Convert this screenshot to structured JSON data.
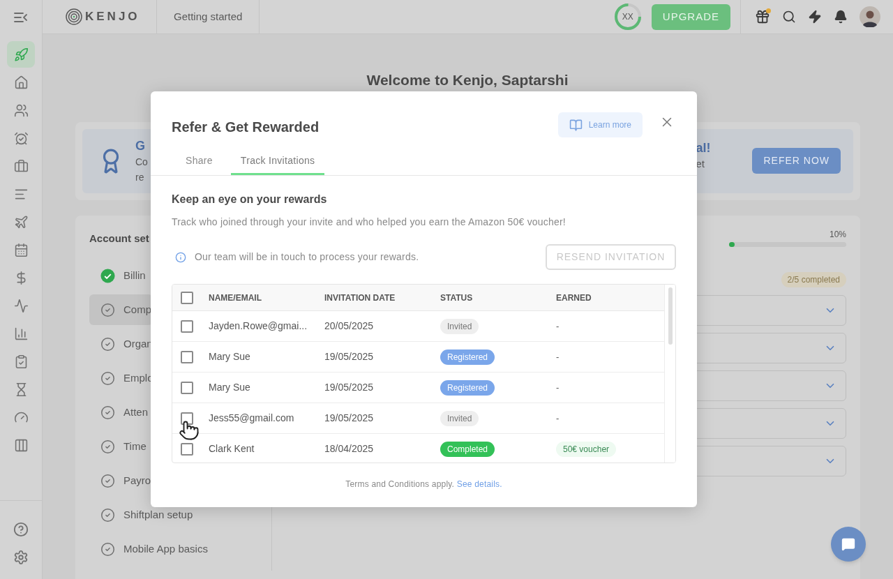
{
  "header": {
    "logo": "KENJO",
    "section": "Getting started",
    "progress": {
      "initials": "XX",
      "level": 0.75
    },
    "upgrade": "UPGRADE",
    "gift_notification": true
  },
  "sidebar": {
    "items": [
      {
        "selected": true
      },
      {
        "selected": false
      },
      {
        "selected": false
      },
      {
        "selected": false
      },
      {
        "selected": false
      },
      {
        "selected": false
      },
      {
        "selected": false
      },
      {
        "selected": false
      },
      {
        "selected": false
      },
      {
        "selected": false
      },
      {
        "selected": false
      },
      {
        "selected": false
      },
      {
        "selected": false
      },
      {
        "selected": false
      },
      {
        "selected": false
      }
    ]
  },
  "welcome": "Welcome to Kenjo, Saptarshi",
  "banner": {
    "title_start": "G",
    "line1_start": "Co",
    "line2_start": "re",
    "title_end": "al!",
    "line1_end": "et",
    "button": "REFER NOW"
  },
  "setup": {
    "title": "Account set",
    "items": [
      {
        "label": "Billin",
        "done": true,
        "selected": false
      },
      {
        "label": "Comp",
        "done": false,
        "selected": true
      },
      {
        "label": "Organ",
        "done": false,
        "selected": false
      },
      {
        "label": "Emplo",
        "done": false,
        "selected": false
      },
      {
        "label": "Atten",
        "done": false,
        "selected": false
      },
      {
        "label": "Time",
        "done": false,
        "selected": false
      },
      {
        "label": "Payro",
        "done": false,
        "selected": false
      },
      {
        "label": "Shiftplan setup",
        "done": false,
        "selected": false
      },
      {
        "label": "Mobile App basics",
        "done": false,
        "selected": false
      }
    ],
    "percent": "10%",
    "level": 0.04,
    "completed": "2/5 completed",
    "sections": [
      {
        "expanded": false
      },
      {
        "expanded": false
      },
      {
        "expanded": false
      },
      {
        "expanded": false
      },
      {
        "expanded": false
      }
    ]
  },
  "modal": {
    "title": "Refer & Get Rewarded",
    "learn_more": "Learn more",
    "tabs": [
      {
        "label": "Share",
        "selected": false
      },
      {
        "label": "Track Invitations",
        "selected": true
      }
    ],
    "heading": "Keep an eye on your rewards",
    "description": "Track who joined through your invite and who helped you earn the Amazon 50€ voucher!",
    "info": "Our team will be in touch to process your rewards.",
    "resend": {
      "label": "RESEND INVITATION",
      "disabled": true
    },
    "table": {
      "columns": [
        "NAME/EMAIL",
        "INVITATION DATE",
        "STATUS",
        "EARNED"
      ],
      "all_checked": false,
      "rows": [
        {
          "checked": false,
          "name": "Jayden.Rowe@gmai...",
          "date": "20/05/2025",
          "status": {
            "label": "Invited",
            "kind": "invited"
          },
          "earned": {
            "text": "-",
            "kind": "plain"
          }
        },
        {
          "checked": false,
          "name": "Mary Sue",
          "date": "19/05/2025",
          "status": {
            "label": "Registered",
            "kind": "registered"
          },
          "earned": {
            "text": "-",
            "kind": "plain"
          }
        },
        {
          "checked": false,
          "name": "Mary Sue",
          "date": "19/05/2025",
          "status": {
            "label": "Registered",
            "kind": "registered"
          },
          "earned": {
            "text": "-",
            "kind": "plain"
          }
        },
        {
          "checked": false,
          "name": "Jess55@gmail.com",
          "date": "19/05/2025",
          "status": {
            "label": "Invited",
            "kind": "invited"
          },
          "earned": {
            "text": "-",
            "kind": "plain"
          }
        },
        {
          "checked": false,
          "name": "Clark Kent",
          "date": "18/04/2025",
          "status": {
            "label": "Completed",
            "kind": "completed"
          },
          "earned": {
            "text": "50€ voucher",
            "kind": "badge"
          }
        }
      ]
    },
    "terms": "Terms and Conditions apply.",
    "terms_link": "See details."
  }
}
